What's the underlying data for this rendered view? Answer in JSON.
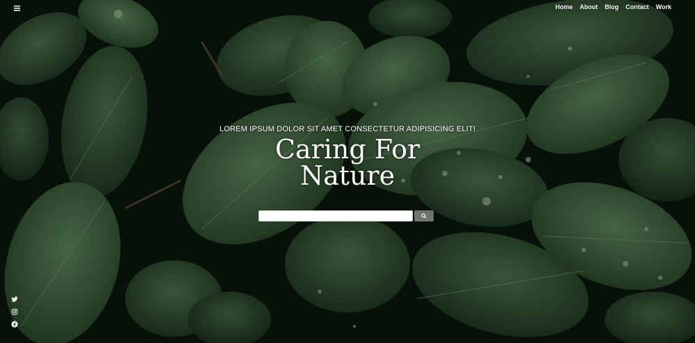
{
  "nav": {
    "menu_icon": "hamburger-icon",
    "links": [
      "Home",
      "About",
      "Blog",
      "Contact",
      "Work"
    ]
  },
  "hero": {
    "tagline": "LOREM IPSUM DOLOR SIT AMET CONSECTETUR ADIPISICING ELIT!",
    "title_line1": "Caring For",
    "title_line2": "Nature"
  },
  "search": {
    "placeholder": "",
    "button_icon": "search-icon"
  },
  "social": {
    "icons": [
      "twitter-icon",
      "instagram-icon",
      "facebook-icon"
    ]
  },
  "colors": {
    "background": "#0c1a10",
    "leaf_dark": "#1f3a23",
    "leaf_mid": "#35553a",
    "leaf_light": "#4c6e4e",
    "text": "#ffffff",
    "search_button": "#6e756c"
  }
}
